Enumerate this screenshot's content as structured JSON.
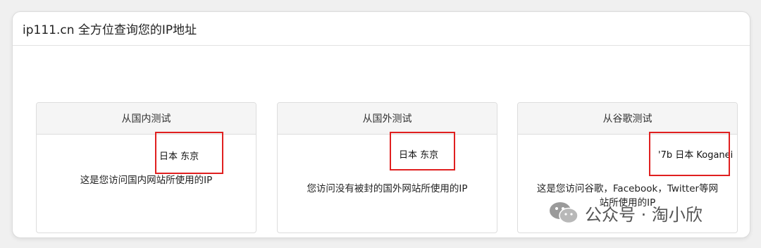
{
  "header": {
    "title": "ip111.cn 全方位查询您的IP地址"
  },
  "cards": [
    {
      "title": "从国内测试",
      "ip_value": "日本 东京",
      "note": "这是您访问国内网站所使用的IP"
    },
    {
      "title": "从国外测试",
      "ip_value": "日本 东京",
      "note": "您访问没有被封的国外网站所使用的IP"
    },
    {
      "title": "从谷歌测试",
      "ip_value": "'7b 日本 Koganei",
      "note_line1": "这是您访问谷歌，Facebook，Twitter等网",
      "note_line2": "站所使用的IP"
    }
  ],
  "watermark": {
    "text": "公众号 · 淘小欣",
    "icon": "wechat-icon"
  },
  "colors": {
    "highlight": "#e02020",
    "card_header_bg": "#f5f5f5"
  }
}
